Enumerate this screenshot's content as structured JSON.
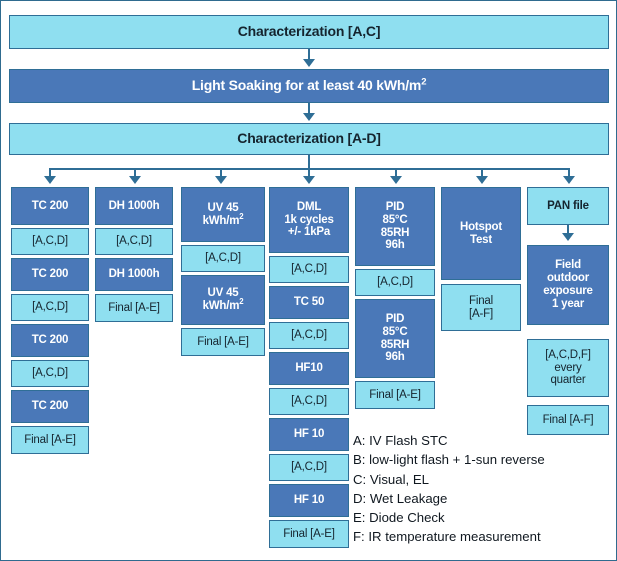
{
  "diagram": {
    "title": "PV module qualification test sequence flowchart",
    "colors": {
      "dark_blue": "#4a78b8",
      "light_blue": "#8fdff0",
      "border": "#2f6e96",
      "connector": "#2f6e96"
    }
  },
  "top": {
    "char1": "Characterization [A,C]",
    "light_soaking": "Light Soaking for at least 40 kWh/m",
    "light_soaking_sup": "2",
    "char2": "Characterization [A-D]"
  },
  "columns": [
    {
      "id": "tc200",
      "boxes": [
        {
          "text": "TC 200",
          "style": "dark"
        },
        {
          "text": "[A,C,D]",
          "style": "light"
        },
        {
          "text": "TC 200",
          "style": "dark"
        },
        {
          "text": "[A,C,D]",
          "style": "light"
        },
        {
          "text": "TC 200",
          "style": "dark"
        },
        {
          "text": "[A,C,D]",
          "style": "light"
        },
        {
          "text": "TC 200",
          "style": "dark"
        },
        {
          "text": "Final [A-E]",
          "style": "light"
        }
      ]
    },
    {
      "id": "dh1000h",
      "boxes": [
        {
          "text": "DH 1000h",
          "style": "dark"
        },
        {
          "text": "[A,C,D]",
          "style": "light"
        },
        {
          "text": "DH 1000h",
          "style": "dark"
        },
        {
          "text": "Final [A-E]",
          "style": "light"
        }
      ]
    },
    {
      "id": "uv45",
      "boxes": [
        {
          "text": "UV 45 kWh/m2",
          "style": "dark"
        },
        {
          "text": "[A,C,D]",
          "style": "light"
        },
        {
          "text": "UV 45 kWh/m2",
          "style": "dark"
        },
        {
          "text": "Final [A-E]",
          "style": "light"
        }
      ]
    },
    {
      "id": "dml",
      "boxes": [
        {
          "text": "DML 1k cycles +/- 1kPa",
          "style": "dark"
        },
        {
          "text": "[A,C,D]",
          "style": "light"
        },
        {
          "text": "TC 50",
          "style": "dark"
        },
        {
          "text": "[A,C,D]",
          "style": "light"
        },
        {
          "text": "HF10",
          "style": "dark"
        },
        {
          "text": "[A,C,D]",
          "style": "light"
        },
        {
          "text": "HF 10",
          "style": "dark"
        },
        {
          "text": "[A,C,D]",
          "style": "light"
        },
        {
          "text": "HF 10",
          "style": "dark"
        },
        {
          "text": "Final [A-E]",
          "style": "light"
        }
      ]
    },
    {
      "id": "pid",
      "boxes": [
        {
          "text": "PID 85°C 85RH 96h",
          "style": "dark"
        },
        {
          "text": "[A,C,D]",
          "style": "light"
        },
        {
          "text": "PID 85°C 85RH 96h",
          "style": "dark"
        },
        {
          "text": "Final [A-E]",
          "style": "light"
        }
      ]
    },
    {
      "id": "hotspot",
      "boxes": [
        {
          "text": "Hotspot Test",
          "style": "dark"
        },
        {
          "text": "Final [A-F]",
          "style": "light"
        }
      ]
    },
    {
      "id": "panfile",
      "boxes": [
        {
          "text": "PAN file",
          "style": "light"
        },
        {
          "text": "Field outdoor exposure 1 year",
          "style": "dark"
        },
        {
          "text": "[A,C,D,F] every quarter",
          "style": "light"
        },
        {
          "text": "Final [A-F]",
          "style": "light"
        }
      ]
    }
  ],
  "cells": {
    "c1_b1": "TC 200",
    "c1_b2": "[A,C,D]",
    "c1_b3": "TC 200",
    "c1_b4": "[A,C,D]",
    "c1_b5": "TC 200",
    "c1_b6": "[A,C,D]",
    "c1_b7": "TC 200",
    "c1_b8": "Final [A-E]",
    "c2_b1": "DH 1000h",
    "c2_b2": "[A,C,D]",
    "c2_b3": "DH 1000h",
    "c2_b4": "Final [A-E]",
    "c3_b1a": "UV 45",
    "c3_b1b": "kWh/m",
    "c3_b1sup": "2",
    "c3_b2": "[A,C,D]",
    "c3_b3a": "UV 45",
    "c3_b3b": "kWh/m",
    "c3_b3sup": "2",
    "c3_b4": "Final [A-E]",
    "c4_b1a": "DML",
    "c4_b1b": "1k cycles",
    "c4_b1c": "+/- 1kPa",
    "c4_b2": "[A,C,D]",
    "c4_b3": "TC 50",
    "c4_b4": "[A,C,D]",
    "c4_b5": "HF10",
    "c4_b6": "[A,C,D]",
    "c4_b7": "HF 10",
    "c4_b8": "[A,C,D]",
    "c4_b9": "HF 10",
    "c4_b10": "Final [A-E]",
    "c5_b1a": "PID",
    "c5_b1b": "85°C",
    "c5_b1c": "85RH",
    "c5_b1d": "96h",
    "c5_b2": "[A,C,D]",
    "c5_b3a": "PID",
    "c5_b3b": "85°C",
    "c5_b3c": "85RH",
    "c5_b3d": "96h",
    "c5_b4": "Final [A-E]",
    "c6_b1a": "Hotspot",
    "c6_b1b": "Test",
    "c6_b2a": "Final",
    "c6_b2b": "[A-F]",
    "c7_b1": "PAN file",
    "c7_b2a": "Field",
    "c7_b2b": "outdoor",
    "c7_b2c": "exposure",
    "c7_b2d": "1 year",
    "c7_b3a": "[A,C,D,F]",
    "c7_b3b": "every",
    "c7_b3c": "quarter",
    "c7_b4": "Final [A-F]"
  },
  "legend": {
    "a": "A: IV Flash STC",
    "b": "B: low-light flash + 1-sun reverse",
    "c": "C: Visual, EL",
    "d": "D: Wet Leakage",
    "e": "E: Diode Check",
    "f": "F: IR temperature measurement"
  }
}
